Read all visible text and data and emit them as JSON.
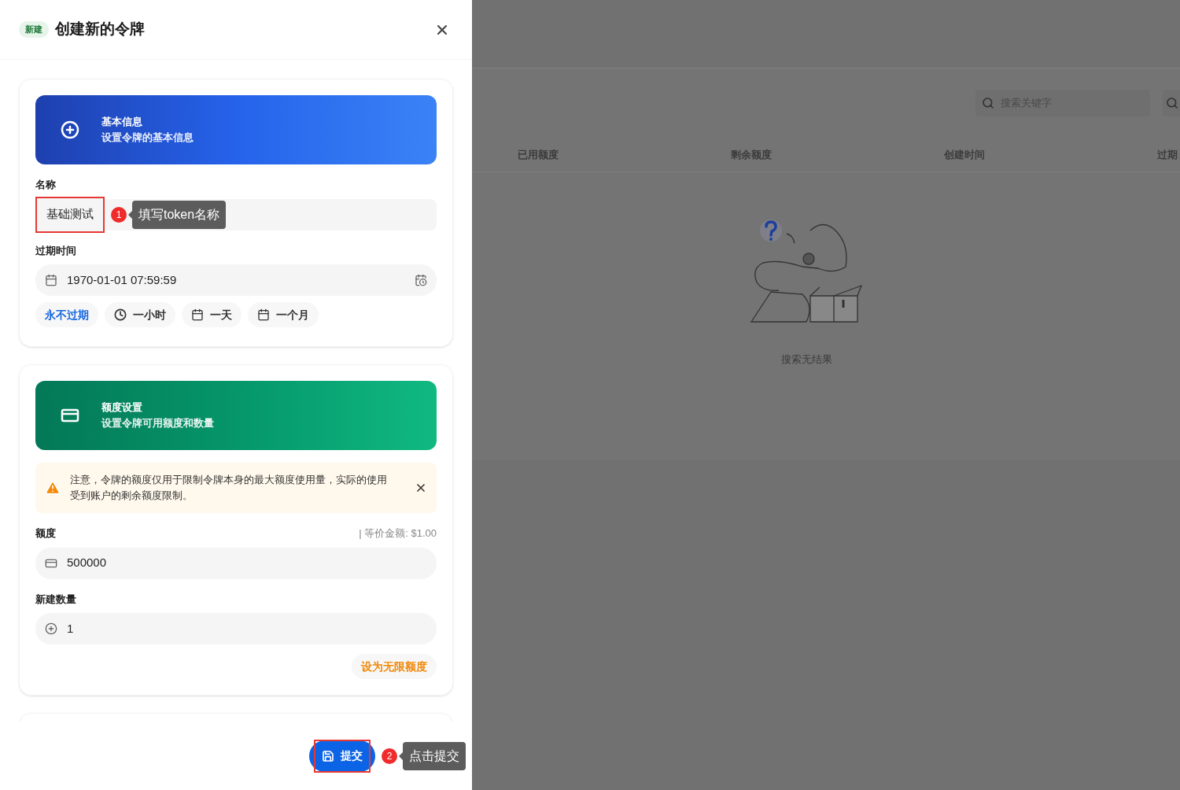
{
  "drawer": {
    "badge": "新建",
    "title": "创建新的令牌"
  },
  "sections": [
    {
      "kind": "basic",
      "title": "基本信息",
      "subtitle": "设置令牌的基本信息"
    },
    {
      "kind": "quota",
      "title": "额度设置",
      "subtitle": "设置令牌可用额度和数量"
    },
    {
      "kind": "access"
    }
  ],
  "name": {
    "label": "名称",
    "value": "基础测试"
  },
  "expiry": {
    "label": "过期时间",
    "value": "1970-01-01 07:59:59",
    "presets": [
      {
        "label": "永不过期",
        "kind": "link"
      },
      {
        "label": "一小时",
        "kind": "clock"
      },
      {
        "label": "一天",
        "kind": "calendar"
      },
      {
        "label": "一个月",
        "kind": "calendar"
      }
    ]
  },
  "notice": {
    "text": "注意，令牌的额度仅用于限制令牌本身的最大额度使用量，实际的使用受到账户的剩余额度限制。"
  },
  "quota": {
    "label": "额度",
    "equivalent": "| 等价金额: $1.00",
    "value": "500000"
  },
  "count": {
    "label": "新建数量",
    "value": "1"
  },
  "unlimited_button": "设为无限额度",
  "submit_button": "提交",
  "annotations": [
    {
      "number": "1",
      "text": "填写token名称"
    },
    {
      "number": "2",
      "text": "点击提交"
    }
  ],
  "background": {
    "search_placeholder": "搜索关键字",
    "columns": [
      "已用额度",
      "剩余额度",
      "创建时间",
      "过期"
    ],
    "empty_text": "搜索无结果"
  }
}
